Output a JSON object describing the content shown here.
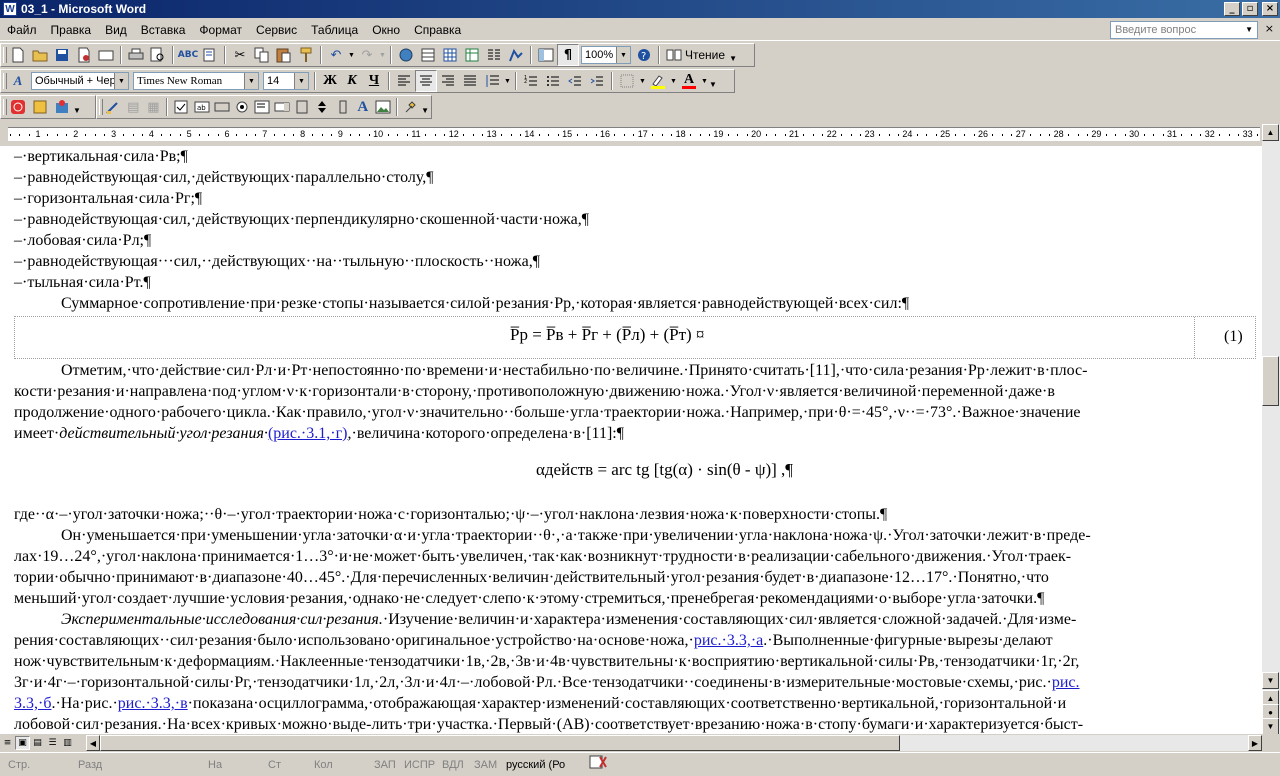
{
  "window": {
    "title": "03_1 - Microsoft Word",
    "app_icon": "W",
    "minimize_label": "_",
    "maximize_label": "▫",
    "close_label": "×"
  },
  "menu": {
    "items": [
      "Файл",
      "Правка",
      "Вид",
      "Вставка",
      "Формат",
      "Сервис",
      "Таблица",
      "Окно",
      "Справка"
    ],
    "help_placeholder": "Введите вопрос",
    "close_doc": "×"
  },
  "toolbar_standard": {
    "zoom": "100%",
    "reading_label": "Чтение"
  },
  "toolbar_formatting": {
    "style": "Обычный + Чер",
    "font": "Times New Roman",
    "size": "14",
    "bold": "Ж",
    "italic": "К",
    "underline": "Ч",
    "font_color_glyph": "A"
  },
  "ruler": {
    "numbers": [
      "1",
      "1",
      "2",
      "3",
      "4",
      "5",
      "6",
      "7",
      "8",
      "9",
      "10",
      "11",
      "12",
      "13",
      "14",
      "15",
      "16",
      "17",
      "18",
      "19",
      "20",
      "21",
      "22",
      "23",
      "24",
      "25",
      "26",
      "27",
      "28",
      "29",
      "30",
      "31",
      "32",
      "33"
    ]
  },
  "document": {
    "list_lines": [
      "–·вертикальная·сила·Pв;¶",
      "–·равнодействующая·сил,·действующих·параллельно·столу,¶",
      "–·горизонтальная·сила·Pг;¶",
      "–·равнодействующая·сил,·действующих·перпендикулярно·скошенной·части·ножа,¶",
      "–·лобовая·сила·Pл;¶",
      "–·равнодействующая···сил,··действующих··на··тыльную··плоскость··ножа,¶",
      "–·тыльная·сила·Pт.¶"
    ],
    "p1": "Суммарное·сопротивление·при·резке·стопы·называется·силой·резания·Pр,·которая·является·равнодействующей·всех·сил:¶",
    "formula1": "P̅р = P̅в + P̅г + (P̅л) + (P̅т) ¤",
    "formula1_number": "(1)",
    "p2_lines": [
      "Отметим,·что·действие·сил·Pл·и·Pт·непостоянно·по·времени·и·нестабильно·по·величине.·Принято·считать·[11],·что·сила·резания·Pр·лежит·в·плос-",
      "кости·резания·и·направлена·под·углом·ν·к·горизонтали·в·сторону,·противоположную·движению·ножа.·Угол·ν·является·величиной·переменной·даже·в",
      "продолжение·одного·рабочего·цикла.·Как·правило,·угол·ν·значительно··больше·угла·траектории·ножа.·Например,·при·θ·=·45°,·ν··=·73°.·Важное·значение"
    ],
    "p2_last_a": "имеет·",
    "p2_last_italic": "действительный·угол·резания·",
    "p2_last_link": "(рис.·3.1,·г)",
    "p2_last_b": ",·величина·которого·определена·в·[11]:¶",
    "formula2": "αдейств = arc tg [tg(α) · sin(θ - ψ)] ,¶",
    "where_line": "где··α·–·угол·заточки·ножа;··θ·–·угол·траектории·ножа·с·горизонталью;·ψ·–·угол·наклона·лезвия·ножа·к·поверхности·стопы.¶",
    "p3_lines": [
      "Он·уменьшается·при·уменьшении·угла·заточки·α·и·угла·траектории··θ·,·а·также·при·увеличении·угла·наклона·ножа·ψ.·Угол·заточки·лежит·в·преде-",
      "лах·19…24°,·угол·наклона·принимается·1…3°·и·не·может·быть·увеличен,·так·как·возникнут·трудности·в·реализации·сабельного·движения.·Угол·траек-",
      "тории·обычно·принимают·в·диапазоне·40…45°.·Для·перечисленных·величин·действительный·угол·резания·будет·в·диапазоне·12…17°.·Понятно,·что",
      "меньший·угол·создает·лучшие·условия·резания,·однако·не·следует·слепо·к·этому·стремиться,·пренебрегая·рекомендациями·о·выборе·угла·заточки.¶"
    ],
    "p4_first_italic": "Экспериментальные·исследования·сил·резания.",
    "p4_first_rest": "·Изучение·величин·и·характера·изменения·составляющих·сил·является·сложной·задачей.·Для·изме-",
    "p4_line2_a": "рения·составляющих··сил·резания·было·использовано·оригинальное·устройство·на·основе·ножа,·",
    "p4_line2_link": "рис.·3.3,·а",
    "p4_line2_b": ".·Выполненные·фигурные·вырезы·делают",
    "p4_line3": "нож·чувствительным·к·деформациям.·Наклеенные·тензодатчики·1в,·2в,·3в·и·4в·чувствительны·к·восприятию·вертикальной·силы·Pв,·тензодатчики·1г,·2г,",
    "p4_line4_a": "3г·и·4г·–·горизонтальной·силы·Pг,·тензодатчики·1л,·2л,·3л·и·4л·–·лобовой·Pл.·Все·тензодатчики··соединены·в·измерительные·мостовые·схемы,·рис.·",
    "p4_line4_link": "рис.",
    "p4_line5_link1": "3.3,·б",
    "p4_line5_a": ".·На·рис.·",
    "p4_line5_link2": "рис.·3.3,·в",
    "p4_line5_b": "·показана·осциллограмма,·отображающая·характер·изменений·составляющих·соответственно·вертикальной,·горизонтальной·и",
    "p4_line6": "лобовой·сил·резания.·На·всех·кривых·можно·выде-лить·три·участка.·Первый·(AB)·соответствует·врезанию·ножа·в·стопу·бумаги·и·характеризуется·быст-"
  },
  "statusbar": {
    "page": "Стр.",
    "section": "Разд",
    "at": "На",
    "line": "Ст",
    "col": "Кол",
    "rec": "ЗАП",
    "trk": "ИСПР",
    "ext": "ВДЛ",
    "ovr": "ЗАМ",
    "language": "русский (Ро"
  }
}
